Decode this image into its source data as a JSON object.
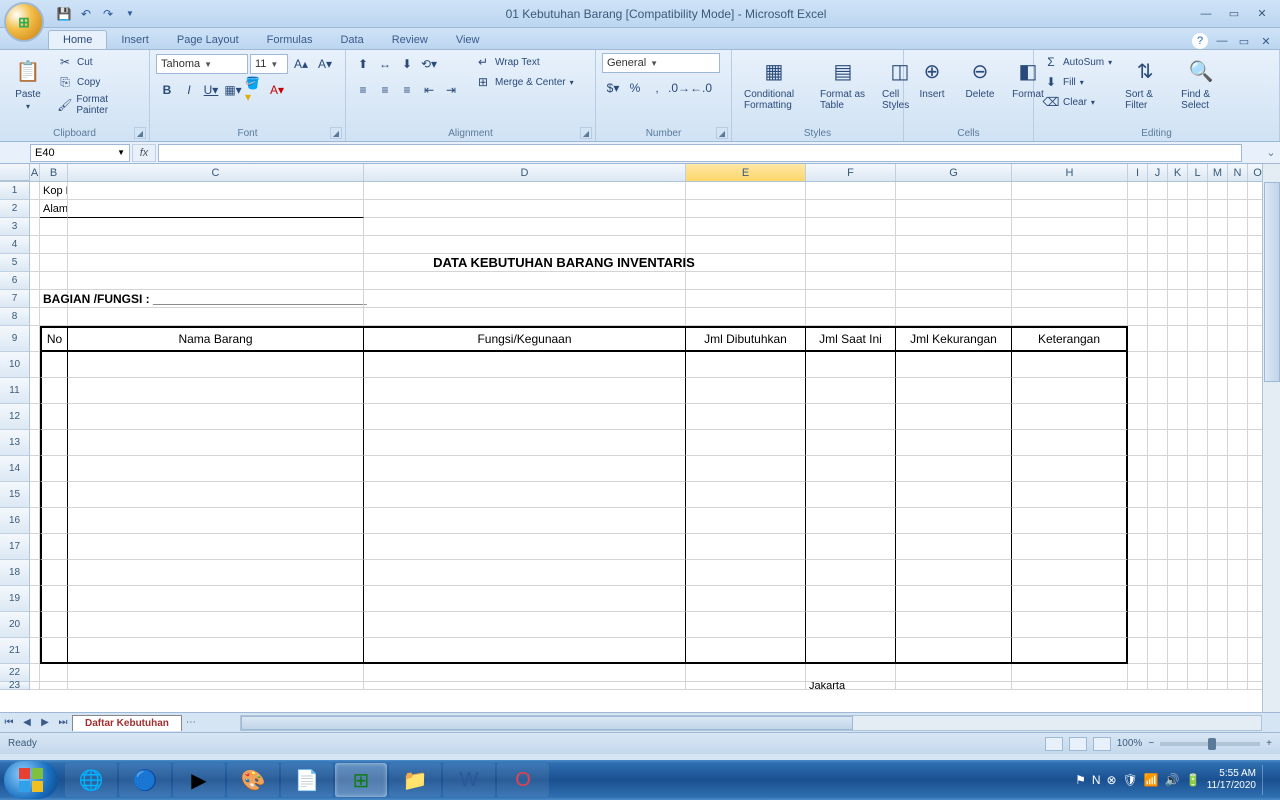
{
  "title": "01 Kebutuhan Barang  [Compatibility Mode] - Microsoft Excel",
  "tabs": [
    "Home",
    "Insert",
    "Page Layout",
    "Formulas",
    "Data",
    "Review",
    "View"
  ],
  "clipboard": {
    "paste": "Paste",
    "cut": "Cut",
    "copy": "Copy",
    "fmt": "Format Painter",
    "label": "Clipboard"
  },
  "font": {
    "name": "Tahoma",
    "size": "11",
    "label": "Font"
  },
  "alignment": {
    "wrap": "Wrap Text",
    "merge": "Merge & Center",
    "label": "Alignment"
  },
  "number": {
    "fmt": "General",
    "label": "Number"
  },
  "styles": {
    "cond": "Conditional Formatting",
    "fmtTbl": "Format as Table",
    "cellSty": "Cell Styles",
    "label": "Styles"
  },
  "cells": {
    "ins": "Insert",
    "del": "Delete",
    "fmt": "Format",
    "label": "Cells"
  },
  "editing": {
    "sum": "AutoSum",
    "fill": "Fill",
    "clear": "Clear",
    "sort": "Sort & Filter",
    "find": "Find & Select",
    "label": "Editing"
  },
  "namebox": "E40",
  "cols": [
    "A",
    "B",
    "C",
    "D",
    "E",
    "F",
    "G",
    "H",
    "I",
    "J",
    "K",
    "L",
    "M",
    "N",
    "O"
  ],
  "content": {
    "kop": "Kop Madrasah",
    "alamat": "Alamat Madrasah",
    "title": "DATA KEBUTUHAN BARANG INVENTARIS",
    "bagian": "BAGIAN /FUNGSI : ________________________________",
    "hdr": {
      "no": "No",
      "nama": "Nama Barang",
      "fungsi": "Fungsi/Kegunaan",
      "dibutuhkan": "Jml Dibutuhkan",
      "saat": "Jml Saat Ini",
      "kurang": "Jml Kekurangan",
      "ket": "Keterangan"
    },
    "jakarta": "Jakarta"
  },
  "sheet": "Daftar Kebutuhan",
  "status": "Ready",
  "zoom": "100%",
  "time": "5:55 AM",
  "date": "11/17/2020"
}
